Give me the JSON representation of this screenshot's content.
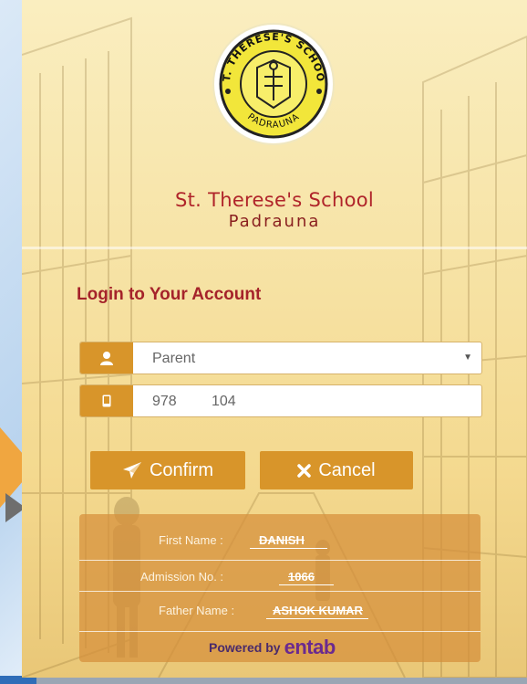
{
  "school": {
    "name": "St. Therese's School",
    "city": "Padrauna",
    "logo_top_text": "ST. THERESE'S SCHOOL",
    "logo_bottom_text": "PADRAUNA"
  },
  "login": {
    "heading": "Login to Your Account",
    "role_value": "Parent",
    "phone_part1": "978",
    "phone_part2": "104",
    "confirm_label": "Confirm",
    "cancel_label": "Cancel"
  },
  "details": {
    "first_name_label": "First Name :",
    "first_name_value": "DANISH",
    "admission_label": "Admission No. :",
    "admission_value": "1066",
    "father_label": "Father Name :",
    "father_value": "ASHOK KUMAR"
  },
  "footer": {
    "powered_label": "Powered by",
    "brand": "entab"
  },
  "colors": {
    "accent": "#d8952a",
    "brand_red": "#b0242a",
    "logo_yellow": "#f2e63a"
  },
  "icons": {
    "role": "user-icon",
    "phone": "mobile-icon",
    "confirm": "paper-plane-icon",
    "cancel": "close-icon"
  }
}
